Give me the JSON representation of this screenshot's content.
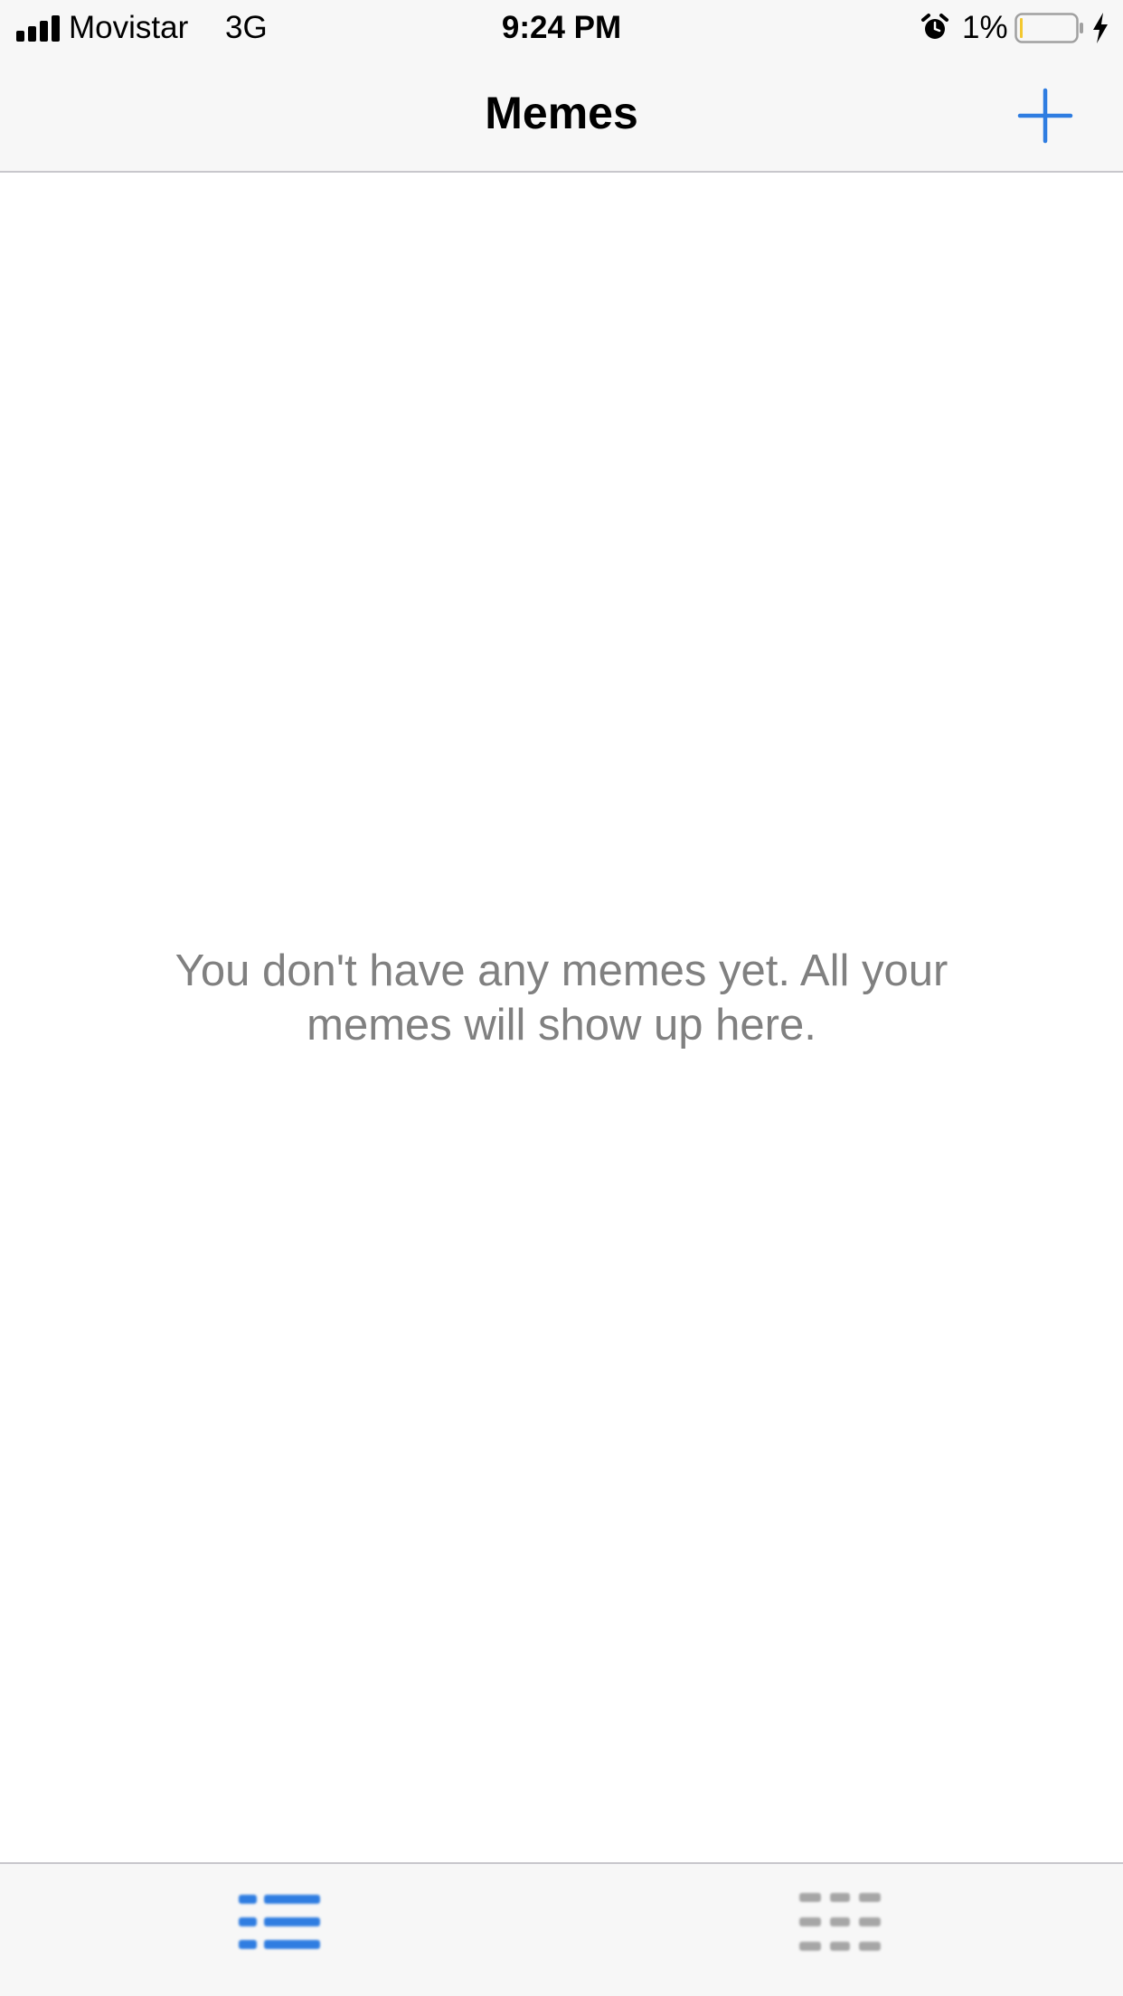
{
  "status_bar": {
    "carrier": "Movistar",
    "network": "3G",
    "time": "9:24 PM",
    "battery_percent": "1%",
    "icons": [
      "signal-icon",
      "alarm-icon",
      "battery-icon",
      "charging-bolt-icon"
    ]
  },
  "nav": {
    "title": "Memes",
    "add_icon": "plus-icon"
  },
  "content": {
    "empty_message": "You don't have any memes yet. All your memes will show up here."
  },
  "tab_bar": {
    "tabs": [
      {
        "icon": "list-icon",
        "selected": true
      },
      {
        "icon": "grid-icon",
        "selected": false
      }
    ]
  },
  "colors": {
    "accent": "#2f7de1",
    "inactive_tab": "#a6a6a6",
    "bar_background": "#f7f7f7",
    "empty_text": "#808080",
    "battery_level": "#f3c830"
  }
}
